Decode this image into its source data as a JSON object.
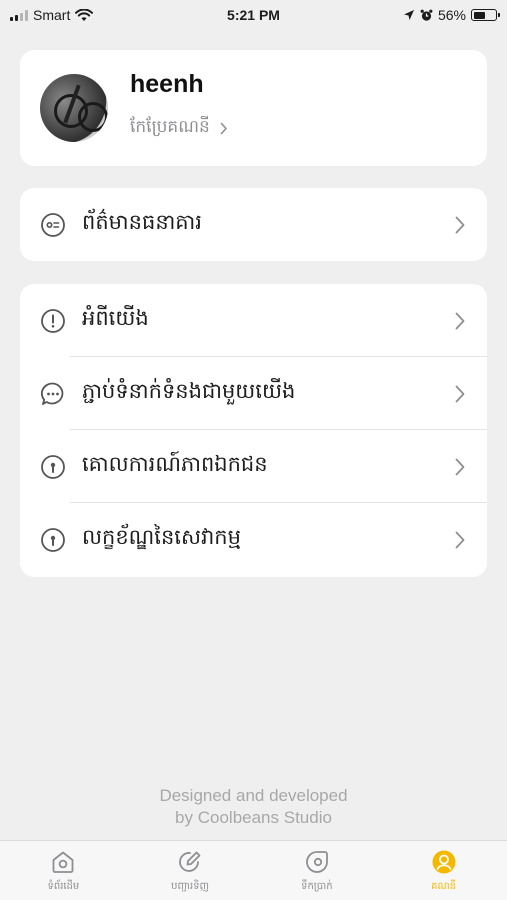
{
  "status_bar": {
    "carrier": "Smart",
    "time": "5:21 PM",
    "battery": "56%",
    "battery_level": 0.56
  },
  "profile": {
    "username": "heenh",
    "edit_label": "កែប្រែគណនី"
  },
  "bank_section": {
    "label": "ព័ត៌មានធនាគារ",
    "icon": "id-card-icon"
  },
  "info_section": {
    "items": [
      {
        "label": "អំពីយើង",
        "icon": "info-icon"
      },
      {
        "label": "ភ្ជាប់ទំនាក់ទំនងជាមួយយើង",
        "icon": "chat-bubble-icon"
      },
      {
        "label": "គោលការណ៍ភាពឯកជន",
        "icon": "lock-icon"
      },
      {
        "label": "លក្ខខ័ណ្ឌនៃសេវាកម្ម",
        "icon": "lock-icon"
      }
    ]
  },
  "footer": {
    "line1": "Designed and developed",
    "line2": "by Coolbeans Studio"
  },
  "tab_bar": {
    "tabs": [
      {
        "label": "ទំព័រដើម",
        "icon": "home-icon",
        "active": false
      },
      {
        "label": "បញ្ជារទិញ",
        "icon": "orders-icon",
        "active": false
      },
      {
        "label": "ទឹកប្រាក់",
        "icon": "wallet-icon",
        "active": false
      },
      {
        "label": "គណនី",
        "icon": "account-icon",
        "active": true
      }
    ],
    "active_color": "#f5b800",
    "inactive_color": "#8e8e93"
  }
}
